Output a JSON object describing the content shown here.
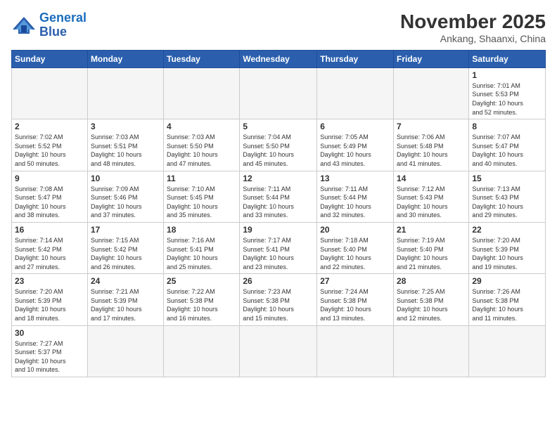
{
  "header": {
    "logo_general": "General",
    "logo_blue": "Blue",
    "month": "November 2025",
    "location": "Ankang, Shaanxi, China"
  },
  "weekdays": [
    "Sunday",
    "Monday",
    "Tuesday",
    "Wednesday",
    "Thursday",
    "Friday",
    "Saturday"
  ],
  "weeks": [
    [
      {
        "day": "",
        "info": ""
      },
      {
        "day": "",
        "info": ""
      },
      {
        "day": "",
        "info": ""
      },
      {
        "day": "",
        "info": ""
      },
      {
        "day": "",
        "info": ""
      },
      {
        "day": "",
        "info": ""
      },
      {
        "day": "1",
        "info": "Sunrise: 7:01 AM\nSunset: 5:53 PM\nDaylight: 10 hours\nand 52 minutes."
      }
    ],
    [
      {
        "day": "2",
        "info": "Sunrise: 7:02 AM\nSunset: 5:52 PM\nDaylight: 10 hours\nand 50 minutes."
      },
      {
        "day": "3",
        "info": "Sunrise: 7:03 AM\nSunset: 5:51 PM\nDaylight: 10 hours\nand 48 minutes."
      },
      {
        "day": "4",
        "info": "Sunrise: 7:03 AM\nSunset: 5:50 PM\nDaylight: 10 hours\nand 47 minutes."
      },
      {
        "day": "5",
        "info": "Sunrise: 7:04 AM\nSunset: 5:50 PM\nDaylight: 10 hours\nand 45 minutes."
      },
      {
        "day": "6",
        "info": "Sunrise: 7:05 AM\nSunset: 5:49 PM\nDaylight: 10 hours\nand 43 minutes."
      },
      {
        "day": "7",
        "info": "Sunrise: 7:06 AM\nSunset: 5:48 PM\nDaylight: 10 hours\nand 41 minutes."
      },
      {
        "day": "8",
        "info": "Sunrise: 7:07 AM\nSunset: 5:47 PM\nDaylight: 10 hours\nand 40 minutes."
      }
    ],
    [
      {
        "day": "9",
        "info": "Sunrise: 7:08 AM\nSunset: 5:47 PM\nDaylight: 10 hours\nand 38 minutes."
      },
      {
        "day": "10",
        "info": "Sunrise: 7:09 AM\nSunset: 5:46 PM\nDaylight: 10 hours\nand 37 minutes."
      },
      {
        "day": "11",
        "info": "Sunrise: 7:10 AM\nSunset: 5:45 PM\nDaylight: 10 hours\nand 35 minutes."
      },
      {
        "day": "12",
        "info": "Sunrise: 7:11 AM\nSunset: 5:44 PM\nDaylight: 10 hours\nand 33 minutes."
      },
      {
        "day": "13",
        "info": "Sunrise: 7:11 AM\nSunset: 5:44 PM\nDaylight: 10 hours\nand 32 minutes."
      },
      {
        "day": "14",
        "info": "Sunrise: 7:12 AM\nSunset: 5:43 PM\nDaylight: 10 hours\nand 30 minutes."
      },
      {
        "day": "15",
        "info": "Sunrise: 7:13 AM\nSunset: 5:43 PM\nDaylight: 10 hours\nand 29 minutes."
      }
    ],
    [
      {
        "day": "16",
        "info": "Sunrise: 7:14 AM\nSunset: 5:42 PM\nDaylight: 10 hours\nand 27 minutes."
      },
      {
        "day": "17",
        "info": "Sunrise: 7:15 AM\nSunset: 5:42 PM\nDaylight: 10 hours\nand 26 minutes."
      },
      {
        "day": "18",
        "info": "Sunrise: 7:16 AM\nSunset: 5:41 PM\nDaylight: 10 hours\nand 25 minutes."
      },
      {
        "day": "19",
        "info": "Sunrise: 7:17 AM\nSunset: 5:41 PM\nDaylight: 10 hours\nand 23 minutes."
      },
      {
        "day": "20",
        "info": "Sunrise: 7:18 AM\nSunset: 5:40 PM\nDaylight: 10 hours\nand 22 minutes."
      },
      {
        "day": "21",
        "info": "Sunrise: 7:19 AM\nSunset: 5:40 PM\nDaylight: 10 hours\nand 21 minutes."
      },
      {
        "day": "22",
        "info": "Sunrise: 7:20 AM\nSunset: 5:39 PM\nDaylight: 10 hours\nand 19 minutes."
      }
    ],
    [
      {
        "day": "23",
        "info": "Sunrise: 7:20 AM\nSunset: 5:39 PM\nDaylight: 10 hours\nand 18 minutes."
      },
      {
        "day": "24",
        "info": "Sunrise: 7:21 AM\nSunset: 5:39 PM\nDaylight: 10 hours\nand 17 minutes."
      },
      {
        "day": "25",
        "info": "Sunrise: 7:22 AM\nSunset: 5:38 PM\nDaylight: 10 hours\nand 16 minutes."
      },
      {
        "day": "26",
        "info": "Sunrise: 7:23 AM\nSunset: 5:38 PM\nDaylight: 10 hours\nand 15 minutes."
      },
      {
        "day": "27",
        "info": "Sunrise: 7:24 AM\nSunset: 5:38 PM\nDaylight: 10 hours\nand 13 minutes."
      },
      {
        "day": "28",
        "info": "Sunrise: 7:25 AM\nSunset: 5:38 PM\nDaylight: 10 hours\nand 12 minutes."
      },
      {
        "day": "29",
        "info": "Sunrise: 7:26 AM\nSunset: 5:38 PM\nDaylight: 10 hours\nand 11 minutes."
      }
    ],
    [
      {
        "day": "30",
        "info": "Sunrise: 7:27 AM\nSunset: 5:37 PM\nDaylight: 10 hours\nand 10 minutes."
      },
      {
        "day": "",
        "info": ""
      },
      {
        "day": "",
        "info": ""
      },
      {
        "day": "",
        "info": ""
      },
      {
        "day": "",
        "info": ""
      },
      {
        "day": "",
        "info": ""
      },
      {
        "day": "",
        "info": ""
      }
    ]
  ]
}
